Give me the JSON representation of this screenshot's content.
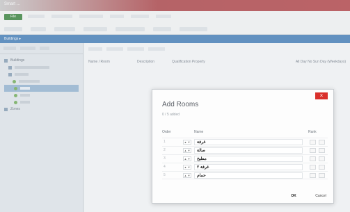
{
  "window": {
    "title": "Smart ...",
    "ribbon_active_tab": "File",
    "ribbon_tabs": [
      "",
      "",
      "",
      "",
      "",
      ""
    ],
    "ribbon_tools": [
      "",
      "",
      "",
      "",
      "",
      "",
      ""
    ],
    "breadcrumb": "Buildings ▸"
  },
  "left_pane": {
    "tree": [
      {
        "label": "Buildings"
      },
      {
        "label": "",
        "selected": false
      },
      {
        "label": "",
        "selected": false
      },
      {
        "label": "",
        "selected": false
      },
      {
        "label": "",
        "selected": true
      },
      {
        "label": "",
        "selected": false
      },
      {
        "label": "",
        "selected": false
      },
      {
        "label": "Zones"
      }
    ]
  },
  "main": {
    "columns": [
      "Name / Room",
      "Description",
      "Qualification Property",
      "All Day No Sun Day (Weekdays)"
    ]
  },
  "dialog": {
    "title": "Add Rooms",
    "subtitle": "0 / 5 added",
    "col_order": "Order",
    "col_name": "Name",
    "col_extra": "Rank",
    "rows": [
      {
        "name": "غرفة",
        "order": "1"
      },
      {
        "name": "صالة",
        "order": "2"
      },
      {
        "name": "مطبخ",
        "order": "3"
      },
      {
        "name": "غرفة ٢",
        "order": "4"
      },
      {
        "name": "حمام",
        "order": "5"
      }
    ],
    "ok_label": "OK",
    "cancel_label": "Cancel"
  }
}
